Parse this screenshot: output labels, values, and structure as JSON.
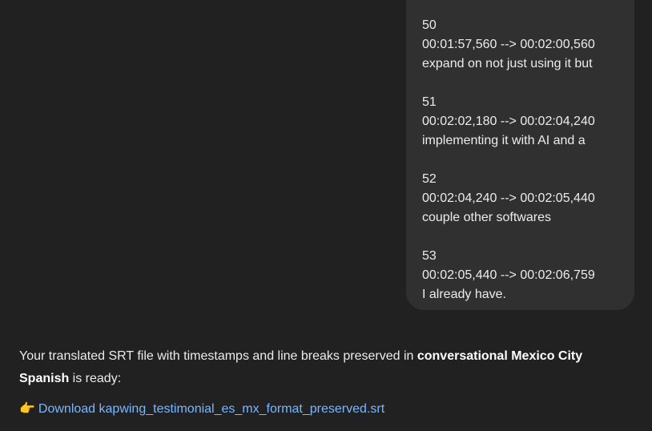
{
  "user_message": {
    "srt_entries": [
      {
        "index": "50",
        "timing": "00:01:57,560 --> 00:02:00,560",
        "text": "expand on not just using it but"
      },
      {
        "index": "51",
        "timing": "00:02:02,180 --> 00:02:04,240",
        "text": "implementing it with AI and a"
      },
      {
        "index": "52",
        "timing": "00:02:04,240 --> 00:02:05,440",
        "text": "couple other softwares"
      },
      {
        "index": "53",
        "timing": "00:02:05,440 --> 00:02:06,759",
        "text": "I already have."
      }
    ]
  },
  "assistant_message": {
    "intro_text": "Your translated SRT file with timestamps and line breaks preserved in ",
    "bold_text": "conversational Mexico City Spanish",
    "outro_text": " is ready:",
    "download_emoji": "👉",
    "download_label": "Download kapwing_testimonial_es_mx_format_preserved.srt"
  },
  "colors": {
    "background": "#212121",
    "user_bubble": "#303030",
    "link": "#7ab7ff"
  }
}
